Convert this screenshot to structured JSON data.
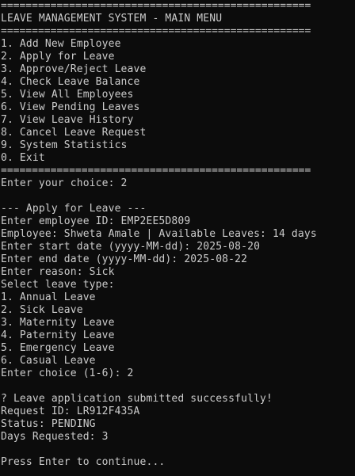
{
  "menu": {
    "separator": "==================================================",
    "title": "LEAVE MANAGEMENT SYSTEM - MAIN MENU",
    "items": [
      "1. Add New Employee",
      "2. Apply for Leave",
      "3. Approve/Reject Leave",
      "4. Check Leave Balance",
      "5. View All Employees",
      "6. View Pending Leaves",
      "7. View Leave History",
      "8. Cancel Leave Request",
      "9. System Statistics",
      "0. Exit"
    ],
    "choice_prompt": "Enter your choice: 2"
  },
  "apply": {
    "header": "--- Apply for Leave ---",
    "employee_id": "Enter employee ID: EMP2EE5D809",
    "employee_info": "Employee: Shweta Amale | Available Leaves: 14 days",
    "start_date": "Enter start date (yyyy-MM-dd): 2025-08-20",
    "end_date": "Enter end date (yyyy-MM-dd): 2025-08-22",
    "reason": "Enter reason: Sick",
    "leave_type_prompt": "Select leave type:",
    "leave_types": [
      "1. Annual Leave",
      "2. Sick Leave",
      "3. Maternity Leave",
      "4. Paternity Leave",
      "5. Emergency Leave",
      "6. Casual Leave"
    ],
    "choice": "Enter choice (1-6): 2"
  },
  "result": {
    "success": "? Leave application submitted successfully!",
    "request_id": "Request ID: LR912F435A",
    "status": "Status: PENDING",
    "days": "Days Requested: 3"
  },
  "continue_prompt": "Press Enter to continue...",
  "colors": {
    "background": "#0c0c0c",
    "text": "#cccccc"
  }
}
